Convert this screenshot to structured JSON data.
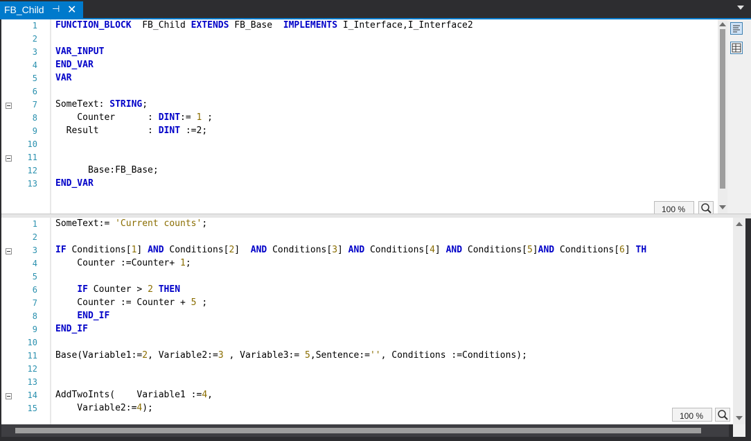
{
  "tab": {
    "title": "FB_Child",
    "pin_icon": "pin-icon",
    "close_icon": "close-icon"
  },
  "top_editor": {
    "zoom": "100 %",
    "lines": [
      {
        "n": "1",
        "fold": false,
        "tokens": [
          [
            "k",
            "FUNCTION_BLOCK"
          ],
          [
            "t",
            "  FB_Child "
          ],
          [
            "k",
            "EXTENDS"
          ],
          [
            "t",
            " FB_Base  "
          ],
          [
            "k",
            "IMPLEMENTS"
          ],
          [
            "t",
            " I_Interface,I_Interface2"
          ]
        ]
      },
      {
        "n": "2",
        "fold": false,
        "tokens": []
      },
      {
        "n": "3",
        "fold": false,
        "tokens": [
          [
            "k",
            "VAR_INPUT"
          ]
        ]
      },
      {
        "n": "4",
        "fold": false,
        "tokens": [
          [
            "k",
            "END_VAR"
          ]
        ]
      },
      {
        "n": "5",
        "fold": false,
        "tokens": [
          [
            "k",
            "VAR"
          ]
        ]
      },
      {
        "n": "6",
        "fold": false,
        "tokens": []
      },
      {
        "n": "7",
        "fold": true,
        "tokens": [
          [
            "t",
            "SomeText: "
          ],
          [
            "k",
            "STRING"
          ],
          [
            "t",
            ";"
          ]
        ]
      },
      {
        "n": "8",
        "fold": false,
        "tokens": [
          [
            "t",
            "    Counter      : "
          ],
          [
            "k",
            "DINT"
          ],
          [
            "t",
            ":= "
          ],
          [
            "n",
            "1"
          ],
          [
            "t",
            " ;"
          ]
        ]
      },
      {
        "n": "9",
        "fold": false,
        "tokens": [
          [
            "t",
            "  Result         : "
          ],
          [
            "k",
            "DINT"
          ],
          [
            "t",
            " :=2;"
          ]
        ]
      },
      {
        "n": "10",
        "fold": false,
        "tokens": []
      },
      {
        "n": "11",
        "fold": true,
        "tokens": []
      },
      {
        "n": "12",
        "fold": false,
        "tokens": [
          [
            "t",
            "      Base:FB_Base;"
          ]
        ]
      },
      {
        "n": "13",
        "fold": false,
        "tokens": [
          [
            "k",
            "END_VAR"
          ]
        ]
      }
    ]
  },
  "bottom_editor": {
    "zoom": "100 %",
    "lines": [
      {
        "n": "1",
        "fold": false,
        "tokens": [
          [
            "t",
            "SomeText:= "
          ],
          [
            "s",
            "'Current counts'"
          ],
          [
            "t",
            ";"
          ]
        ]
      },
      {
        "n": "2",
        "fold": false,
        "tokens": []
      },
      {
        "n": "3",
        "fold": true,
        "tokens": [
          [
            "k",
            "IF"
          ],
          [
            "t",
            " Conditions["
          ],
          [
            "n",
            "1"
          ],
          [
            "t",
            "] "
          ],
          [
            "k",
            "AND"
          ],
          [
            "t",
            " Conditions["
          ],
          [
            "n",
            "2"
          ],
          [
            "t",
            "]  "
          ],
          [
            "k",
            "AND"
          ],
          [
            "t",
            " Conditions["
          ],
          [
            "n",
            "3"
          ],
          [
            "t",
            "] "
          ],
          [
            "k",
            "AND"
          ],
          [
            "t",
            " Conditions["
          ],
          [
            "n",
            "4"
          ],
          [
            "t",
            "] "
          ],
          [
            "k",
            "AND"
          ],
          [
            "t",
            " Conditions["
          ],
          [
            "n",
            "5"
          ],
          [
            "t",
            "]"
          ],
          [
            "k",
            "AND"
          ],
          [
            "t",
            " Conditions["
          ],
          [
            "n",
            "6"
          ],
          [
            "t",
            "] "
          ],
          [
            "k",
            "TH"
          ]
        ]
      },
      {
        "n": "4",
        "fold": false,
        "tokens": [
          [
            "t",
            "    Counter :=Counter+ "
          ],
          [
            "n",
            "1"
          ],
          [
            "t",
            ";"
          ]
        ]
      },
      {
        "n": "5",
        "fold": false,
        "tokens": []
      },
      {
        "n": "6",
        "fold": false,
        "tokens": [
          [
            "t",
            "    "
          ],
          [
            "k",
            "IF"
          ],
          [
            "t",
            " Counter > "
          ],
          [
            "n",
            "2"
          ],
          [
            "t",
            " "
          ],
          [
            "k",
            "THEN"
          ]
        ]
      },
      {
        "n": "7",
        "fold": false,
        "tokens": [
          [
            "t",
            "    Counter := Counter + "
          ],
          [
            "n",
            "5"
          ],
          [
            "t",
            " ;"
          ]
        ]
      },
      {
        "n": "8",
        "fold": false,
        "tokens": [
          [
            "t",
            "    "
          ],
          [
            "k",
            "END_IF"
          ]
        ]
      },
      {
        "n": "9",
        "fold": false,
        "tokens": [
          [
            "k",
            "END_IF"
          ]
        ]
      },
      {
        "n": "10",
        "fold": false,
        "tokens": []
      },
      {
        "n": "11",
        "fold": false,
        "tokens": [
          [
            "t",
            "Base(Variable1:="
          ],
          [
            "n",
            "2"
          ],
          [
            "t",
            ", Variable2:="
          ],
          [
            "n",
            "3"
          ],
          [
            "t",
            " , Variable3:= "
          ],
          [
            "n",
            "5"
          ],
          [
            "t",
            ",Sentence:="
          ],
          [
            "s",
            "''"
          ],
          [
            "t",
            ", Conditions :=Conditions);"
          ]
        ]
      },
      {
        "n": "12",
        "fold": false,
        "tokens": []
      },
      {
        "n": "13",
        "fold": false,
        "tokens": []
      },
      {
        "n": "14",
        "fold": true,
        "tokens": [
          [
            "t",
            "AddTwoInts(    Variable1 :="
          ],
          [
            "n",
            "4"
          ],
          [
            "t",
            ","
          ]
        ]
      },
      {
        "n": "15",
        "fold": false,
        "tokens": [
          [
            "t",
            "    Variable2:="
          ],
          [
            "n",
            "4"
          ],
          [
            "t",
            ");"
          ]
        ]
      }
    ]
  },
  "toolbar": {
    "view_text_icon": "text-view-icon",
    "view_table_icon": "table-view-icon"
  }
}
